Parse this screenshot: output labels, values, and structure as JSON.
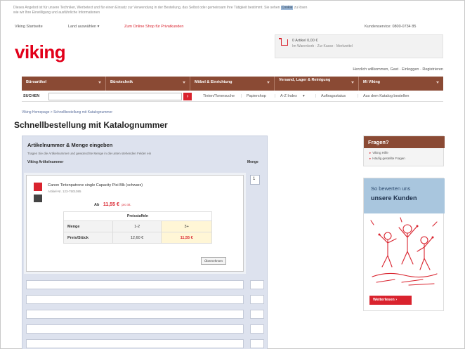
{
  "cookie_notice": {
    "text": "Dieses Angebot ist für unsere Techniker, Werbetext und für einen Einsatz zur Verwendung in der Bestellung, das Selbst oder gemeinsam Ihre Tätigkeit bestimmt. Sie sehen",
    "highlight": "Cookie",
    "text_end": "zu lösen",
    "line2": "wie wir Ihre Einwilligung und ausführliche Informationen"
  },
  "topnav": {
    "home": "Viking Startseite",
    "land": "Land auswählen",
    "promo": "Zum Online Shop für Privatkunden",
    "customer_no": "Kundenservice: 0800-0734 85"
  },
  "logo": {
    "text": "viking"
  },
  "cart": {
    "line1": "0 Artikel  0,00 €",
    "line2": "Im Warenkorb  ·  Zur Kasse  ·  Merkzettel"
  },
  "userlinks": "Herzlich willkommen, Gast · Einloggen · Registrieren",
  "mainnav": {
    "items": [
      {
        "label": "Büroartikel"
      },
      {
        "label": "Bürotechnik"
      },
      {
        "label": "Möbel & Einrichtung"
      },
      {
        "label": "Versand, Lager & Reinigung"
      },
      {
        "label": "Mi Viking"
      }
    ]
  },
  "search": {
    "label": "SUCHEN",
    "placeholder": "",
    "button_glyph": "›",
    "quicklinks": [
      "Tinten/Tonersuche",
      "Papiershop",
      "A-Z Index",
      "Auftragsstatus",
      "Aus dem Katalog bestellen"
    ]
  },
  "breadcrumb": "Viking Homepage  >  Schnellbestellung mit Katalognummer",
  "page_title": "Schnellbestellung mit Katalognummer",
  "form": {
    "title": "Artikelnummer & Menge eingeben",
    "subtitle": "Tragen Sie die Artikelnummer und gewünschte Menge in die unten stehenden Felder ein",
    "col_article": "Viking Artikelnummer",
    "col_qty": "Menge",
    "qty_value": "1",
    "article": {
      "name": "Canon Tintenpatrone single Capacity Pixi Blk (schwarz)",
      "number": "Artikel-Nr. 123-7501085",
      "price_label": "Ab",
      "price": "11,55 €",
      "price_unit": "pro St."
    },
    "price_table": {
      "header": "Preisstaffeln",
      "row1_label": "Menge",
      "row1_c1": "1-2",
      "row1_c2": "3+",
      "row2_label": "Preis/Stück",
      "row2_c1": "12,60 €",
      "row2_c2": "11,55 €"
    },
    "submit_label": "Übernehmen"
  },
  "help": {
    "title": "Fragen?",
    "links": [
      "Viking Hilfe",
      "Häufig gestellte Fragen"
    ]
  },
  "reviews": {
    "line1": "So bewerten uns",
    "line2": "unsere Kunden",
    "button": "Weiterlesen ›"
  },
  "colors": {
    "brand_red": "#d9232e",
    "nav_brown": "#8a4a34",
    "panel_blue": "#dde2ee",
    "review_blue": "#a9c6de"
  }
}
